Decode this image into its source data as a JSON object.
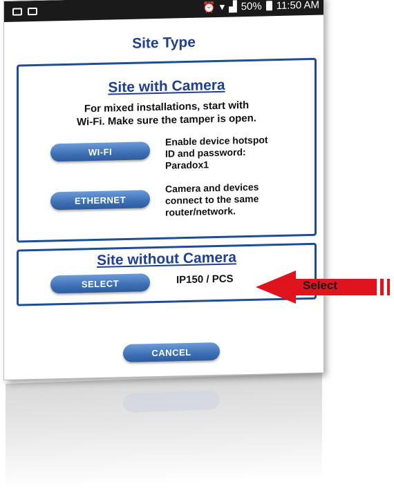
{
  "status_bar": {
    "battery": "50%",
    "time": "11:50 AM"
  },
  "title": "Site Type",
  "camera_panel": {
    "heading": "Site with Camera",
    "description": "For mixed installations, start with\nWi-Fi. Make sure the tamper is open.",
    "wifi": {
      "label": "WI-FI",
      "text": "Enable device hotspot\nID and password:\nParadox1"
    },
    "ethernet": {
      "label": "ETHERNET",
      "text": "Camera and devices\nconnect to the same\nrouter/network."
    }
  },
  "nocamera_panel": {
    "heading": "Site without Camera",
    "select_label": "SELECT",
    "device_text": "IP150 / PCS"
  },
  "cancel_label": "CANCEL",
  "annotation": {
    "label": "Select",
    "color": "#e0141c"
  }
}
